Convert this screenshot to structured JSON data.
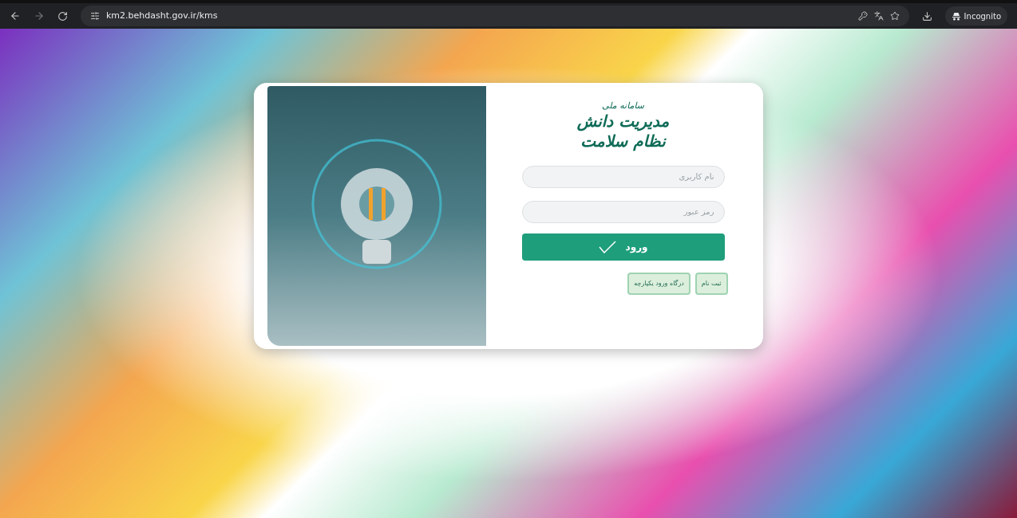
{
  "browser": {
    "url": "km2.behdasht.gov.ir/kms",
    "profile": "Incognito"
  },
  "logo": {
    "line_1": "سامانه ملی",
    "line_2": "مدیریت دانش",
    "line_3": "نظام سلامت"
  },
  "form": {
    "username": {
      "placeholder": "نام کاربری"
    },
    "password": {
      "placeholder": "رمز عبور"
    },
    "login_button": "ورود",
    "secondary_buttons": [
      "ثبت نام",
      "درگاه ورود یکپارچه"
    ]
  }
}
